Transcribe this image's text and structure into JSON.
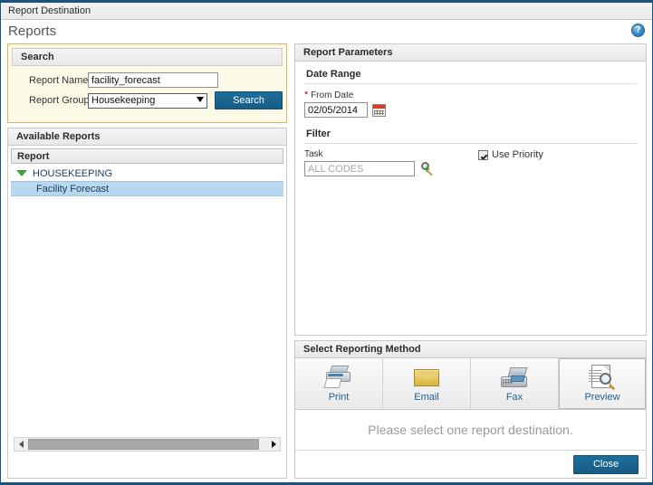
{
  "window": {
    "title": "Report Destination"
  },
  "header": {
    "page_title": "Reports",
    "help_icon": "help-icon",
    "help_glyph": "?"
  },
  "search_panel": {
    "header": "Search",
    "report_name_label": "Report Name",
    "report_name_value": "facility_forecast",
    "report_group_label": "Report Group",
    "report_group_value": "Housekeeping",
    "report_group_options": [
      "Housekeeping"
    ],
    "search_button": "Search"
  },
  "available_reports": {
    "header": "Available Reports",
    "column_header": "Report",
    "groups": [
      {
        "label": "HOUSEKEEPING",
        "expanded": true,
        "expand_icon": "triangle-down-icon",
        "items": [
          {
            "label": "Facility Forecast",
            "selected": true
          }
        ]
      }
    ],
    "scrollbar": {
      "left_arrow_icon": "arrow-left-icon",
      "right_arrow_icon": "arrow-right-icon"
    }
  },
  "report_parameters": {
    "header": "Report Parameters",
    "date_range": {
      "section_title": "Date Range",
      "from_date_label": "From Date",
      "required_marker": "*",
      "from_date_value": "02/05/2014",
      "calendar_icon": "calendar-icon"
    },
    "filter": {
      "section_title": "Filter",
      "task_label": "Task",
      "task_placeholder": "ALL CODES",
      "task_value": "",
      "task_lookup_icon": "search-plus-icon",
      "use_priority_label": "Use Priority",
      "use_priority_checked": true
    }
  },
  "reporting_method": {
    "header": "Select Reporting Method",
    "methods": [
      {
        "label": "Print",
        "icon": "printer-icon",
        "hover": false
      },
      {
        "label": "Email",
        "icon": "envelope-icon",
        "hover": false
      },
      {
        "label": "Fax",
        "icon": "fax-icon",
        "hover": false
      },
      {
        "label": "Preview",
        "icon": "preview-document-icon",
        "hover": true
      }
    ],
    "message": "Please select one report destination.",
    "close_button": "Close"
  },
  "colors": {
    "accent_blue": "#175c85",
    "window_border": "#18557e",
    "search_panel_border": "#d6b656",
    "search_panel_bg": "#fdfbe8",
    "selection_blue": "#b8d8f0",
    "link_blue": "#1e5f95",
    "required_red": "#cc0000",
    "tree_expand_green": "#3f9c3f"
  }
}
